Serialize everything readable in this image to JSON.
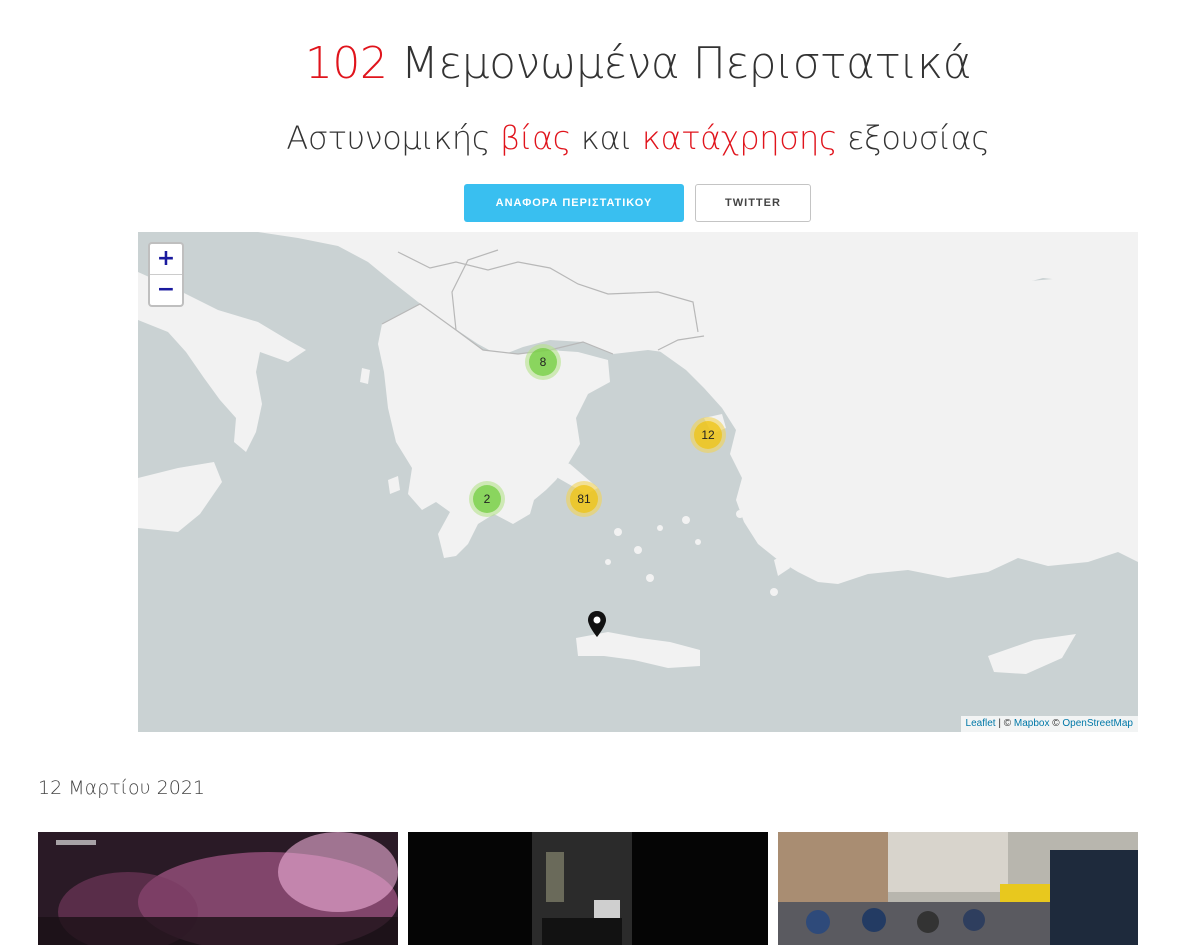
{
  "header": {
    "count": "102",
    "title_rest": "Μεμονωμένα Περιστατικά",
    "subtitle_part1": "Αστυνομικής",
    "subtitle_hl1": "βίας",
    "subtitle_part2": "και",
    "subtitle_hl2": "κατάχρησης",
    "subtitle_part3": "εξουσίας"
  },
  "buttons": {
    "report_label": "ΑΝΑΦΟΡΑ ΠΕΡΙΣΤΑΤΙΚΟΥ",
    "twitter_label": "TWITTER"
  },
  "map": {
    "zoom_in": "+",
    "zoom_out": "−",
    "clusters": [
      {
        "count": "8",
        "color": "green"
      },
      {
        "count": "12",
        "color": "yellow"
      },
      {
        "count": "2",
        "color": "green"
      },
      {
        "count": "81",
        "color": "yellow"
      }
    ],
    "attribution": {
      "leaflet": "Leaflet",
      "separator": "|",
      "copyright1": "©",
      "mapbox": "Mapbox",
      "copyright2": "©",
      "osm": "OpenStreetMap"
    }
  },
  "feed": {
    "date": "12 Μαρτίου 2021",
    "thumbnails": [
      "protest night photo",
      "dark hallway photo",
      "street police van photo"
    ]
  },
  "colors": {
    "accent_red": "#e0141c",
    "button_blue": "#39bff0",
    "cluster_green": "#6ecc39",
    "cluster_yellow": "#f0c20c"
  }
}
